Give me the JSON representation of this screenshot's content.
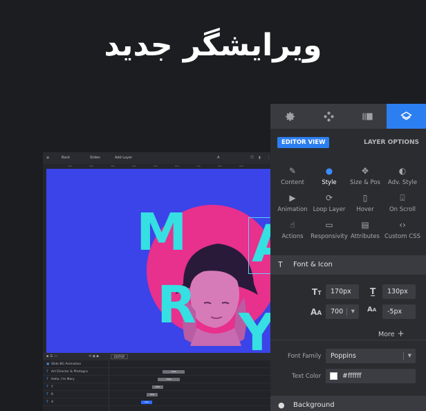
{
  "headline": "ویرایشگر جدید",
  "editor": {
    "toolbar": {
      "back": "Back",
      "slides": "Slides",
      "add_layer": "Add Layer",
      "layer_type": "A"
    },
    "ruler": [
      "100",
      "200",
      "300",
      "400",
      "500",
      "600",
      "700",
      "800",
      "900"
    ],
    "stage_letters": [
      "M",
      "A",
      "R",
      "Y"
    ],
    "timeline": {
      "editor_btn": "EDITOR",
      "rows": [
        {
          "label": "Slide BG Animation",
          "bar": ""
        },
        {
          "label": "Art Director & Photogra",
          "bar": "7000"
        },
        {
          "label": "Hello, I'm Mary",
          "bar": "7000"
        },
        {
          "label": "Y",
          "bar": "600"
        },
        {
          "label": "R",
          "bar": "600"
        },
        {
          "label": "A",
          "bar": "900"
        }
      ]
    }
  },
  "panel": {
    "tabs": [
      {
        "icon": "gear-icon"
      },
      {
        "icon": "navigation-icon"
      },
      {
        "icon": "slides-icon"
      },
      {
        "icon": "layers-icon"
      }
    ],
    "editor_view": "EDITOR VIEW",
    "layer_options": "LAYER OPTIONS",
    "options": [
      [
        "Content",
        "Style",
        "Size & Pos",
        "Adv. Style"
      ],
      [
        "Animation",
        "Loop Layer",
        "Hover",
        "On Scroll"
      ],
      [
        "Actions",
        "Responsivity",
        "Attributes",
        "Custom CSS"
      ]
    ],
    "font_section": "Font & Icon",
    "font_size": "170px",
    "line_height": "130px",
    "font_weight": "700",
    "letter_spacing": "-5px",
    "more": "More",
    "font_family_label": "Font Family",
    "font_family": "Poppins",
    "text_color_label": "Text Color",
    "text_color": "#ffffff",
    "background_section": "Background",
    "accent": "#2c7ff0"
  }
}
